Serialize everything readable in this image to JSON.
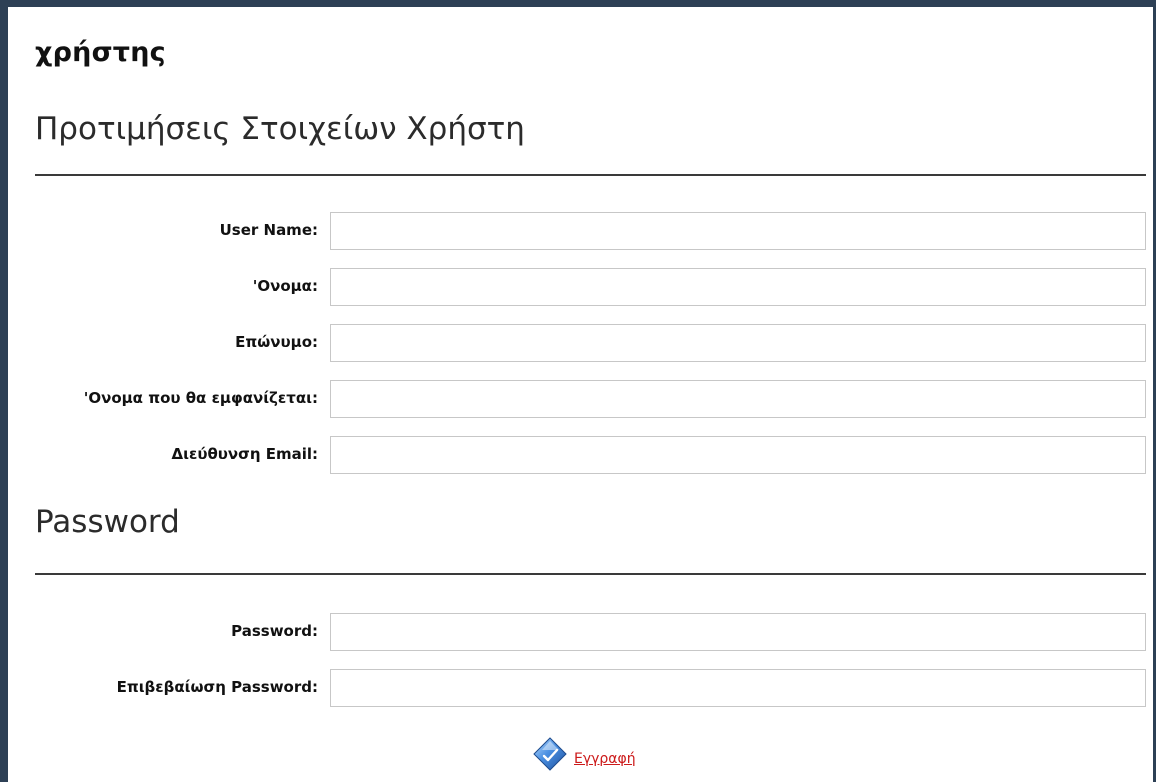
{
  "module": {
    "title": "χρήστης"
  },
  "sections": {
    "preferences_title": "Προτιμήσεις Στοιχείων Χρήστη",
    "password_title": "Password"
  },
  "profile_fields": [
    {
      "label": "User Name:",
      "value": ""
    },
    {
      "label": "'Ονομα:",
      "value": ""
    },
    {
      "label": "Επώνυμο:",
      "value": ""
    },
    {
      "label": "'Ονομα που θα εμφανίζεται:",
      "value": ""
    },
    {
      "label": "Διεύθυνση Email:",
      "value": ""
    }
  ],
  "password_fields": [
    {
      "label": "Password:",
      "value": ""
    },
    {
      "label": "Επιβεβαίωση Password:",
      "value": ""
    }
  ],
  "actions": {
    "register_label": "Εγγραφή",
    "register_icon": "register-diamond-icon"
  },
  "colors": {
    "frame": "#2d4055",
    "link": "#cc1a1a"
  }
}
